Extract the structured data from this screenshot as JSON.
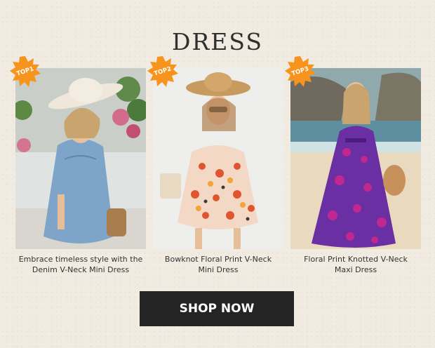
{
  "header": {
    "title": "DRESS"
  },
  "products": [
    {
      "badge": "TOP1",
      "caption_line1": "Embrace timeless style with the",
      "caption_line2": "Denim V-Neck Mini Dress"
    },
    {
      "badge": "TOP2",
      "caption_line1": "Bowknot Floral Print V-Neck",
      "caption_line2": "Mini Dress"
    },
    {
      "badge": "TOP3",
      "caption_line1": "Floral Print Knotted V-Neck",
      "caption_line2": "Maxi Dress"
    }
  ],
  "cta": {
    "label": "SHOP NOW"
  },
  "colors": {
    "badge": "#f7941d",
    "button": "#242424",
    "background": "#f1ebe2"
  }
}
